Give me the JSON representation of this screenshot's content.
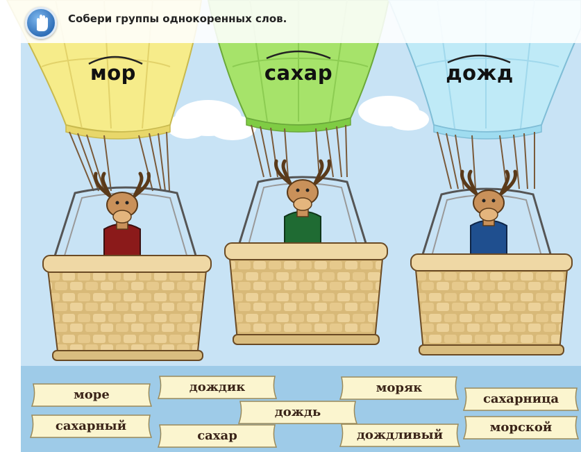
{
  "instruction": {
    "text": "Собери группы однокоренных слов.",
    "hand_icon": "hand-icon"
  },
  "balloons": [
    {
      "root": "мор",
      "color": "#f6ec8a",
      "sweater_color": "#8b1a1a"
    },
    {
      "root": "сахар",
      "color": "#a6e36a",
      "sweater_color": "#1f6b33"
    },
    {
      "root": "дожд",
      "color": "#bfeaf7",
      "sweater_color": "#1f4f8f"
    }
  ],
  "words": [
    "море",
    "сахарный",
    "дождик",
    "сахар",
    "дождь",
    "моряк",
    "дождливый",
    "сахарница",
    "морской"
  ],
  "colors": {
    "sky": "#c8e3f5",
    "tray": "#9ecbe8",
    "card": "#fbf5cf",
    "basket": "#e0c38c"
  }
}
